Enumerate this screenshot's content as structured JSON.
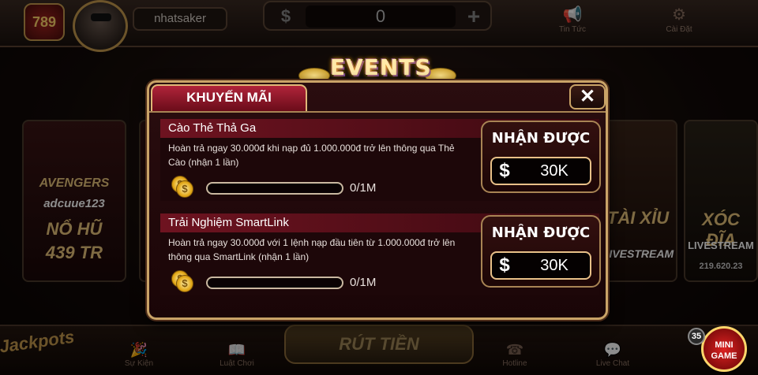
{
  "header": {
    "logo_text": "789",
    "username": "nhatsaker",
    "balance": "0",
    "currency_icon": "$",
    "nav": [
      {
        "label": "Tin Tức",
        "icon": "megaphone-icon"
      },
      {
        "label": "Cài Đặt",
        "icon": "gear-icon"
      }
    ]
  },
  "events_banner": {
    "title": "EVENTS"
  },
  "background_cards": {
    "left": {
      "line1": "AVENGERS",
      "line2": "adcuue123",
      "line3": "NỔ HŨ",
      "line4": "439 TR"
    },
    "mid": {
      "line1": "TÀI XỈU",
      "line2": "LIVESTREAM"
    },
    "right": {
      "line1": "XÓC ĐĨA",
      "line2": "LIVESTREAM",
      "amount": "219.620.23"
    }
  },
  "modal": {
    "tab_label": "KHUYẾN MÃI",
    "close_label": "✕",
    "promotions": [
      {
        "title": "Cào Thẻ Thả Ga",
        "description": "Hoàn trả ngay 30.000đ khi nạp đủ 1.000.000đ trở lên thông qua Thẻ Cào (nhận 1 lần)",
        "progress_text": "0/1M",
        "progress_fraction": 0,
        "claim_label": "NHẬN ĐƯỢC",
        "claim_amount": "30K",
        "currency_icon": "$"
      },
      {
        "title": "Trải Nghiệm SmartLink",
        "description": "Hoàn trả ngay 30.000đ với 1 lệnh nạp đầu tiên từ 1.000.000đ trở lên thông qua SmartLink (nhận 1 lần)",
        "progress_text": "0/1M",
        "progress_fraction": 0,
        "claim_label": "NHẬN ĐƯỢC",
        "claim_amount": "30K",
        "currency_icon": "$"
      }
    ]
  },
  "bottom_bar": {
    "jackpots_label": "Jackpots",
    "withdraw_label": "RÚT TIỀN",
    "nav": [
      {
        "label": "Sự Kiện",
        "icon": "party-icon"
      },
      {
        "label": "Luật Chơi",
        "icon": "book-icon"
      },
      {
        "label": "Hotline",
        "icon": "phone-icon"
      },
      {
        "label": "Live Chat",
        "icon": "chat-icon"
      }
    ],
    "minigame_label": "MINI GAME",
    "minigame_count": "35"
  }
}
